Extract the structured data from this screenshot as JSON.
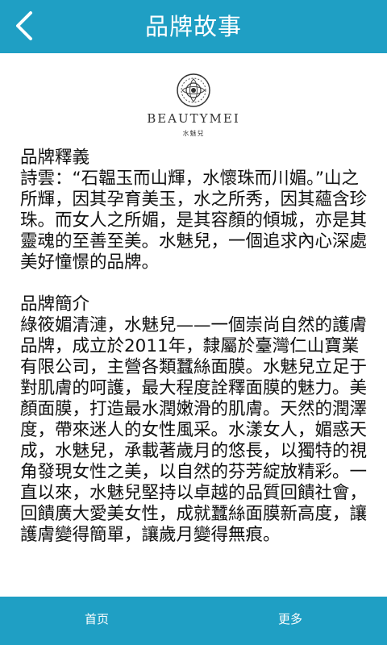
{
  "header": {
    "title": "品牌故事"
  },
  "logo": {
    "name": "BEAUTYMEI",
    "subtitle": "水魅兒"
  },
  "sections": [
    {
      "heading": "品牌釋義",
      "text": "詩雲：“石韞玉而山輝，水懷珠而川媚。”山之所輝，因其孕育美玉，水之所秀，因其蘊含珍珠。而女人之所媚，是其容顏的傾城，亦是其靈魂的至善至美。水魅兒，一個追求內心深處美好憧憬的品牌。"
    },
    {
      "heading": "品牌簡介",
      "text": "綠筱媚清漣，水魅兒——一個崇尚自然的護膚品牌，成立於2011年，隸屬於臺灣仁山寶業有限公司，主營各類蠶絲面膜。水魅兒立足于對肌膚的呵護，最大程度詮釋面膜的魅力。美顏面膜，打造最水潤嫩滑的肌膚。天然的潤澤度，帶來迷人的女性風采。水漾女人，媚惑天成，水魅兒，承載著歲月的悠長，以獨特的視角發現女性之美，以自然的芬芳綻放精彩。一直以來，水魅兒堅持以卓越的品質回饋社會，回饋廣大愛美女性，成就蠶絲面膜新高度，讓護膚變得簡單，讓歲月變得無痕。"
    }
  ],
  "tabbar": {
    "home_label": "首页",
    "more_label": "更多"
  },
  "colors": {
    "primary": "#1f9fc4",
    "text": "#111111"
  },
  "icons": {
    "back": "chevron-left-icon",
    "logo": "ornamental-circle-logo"
  }
}
